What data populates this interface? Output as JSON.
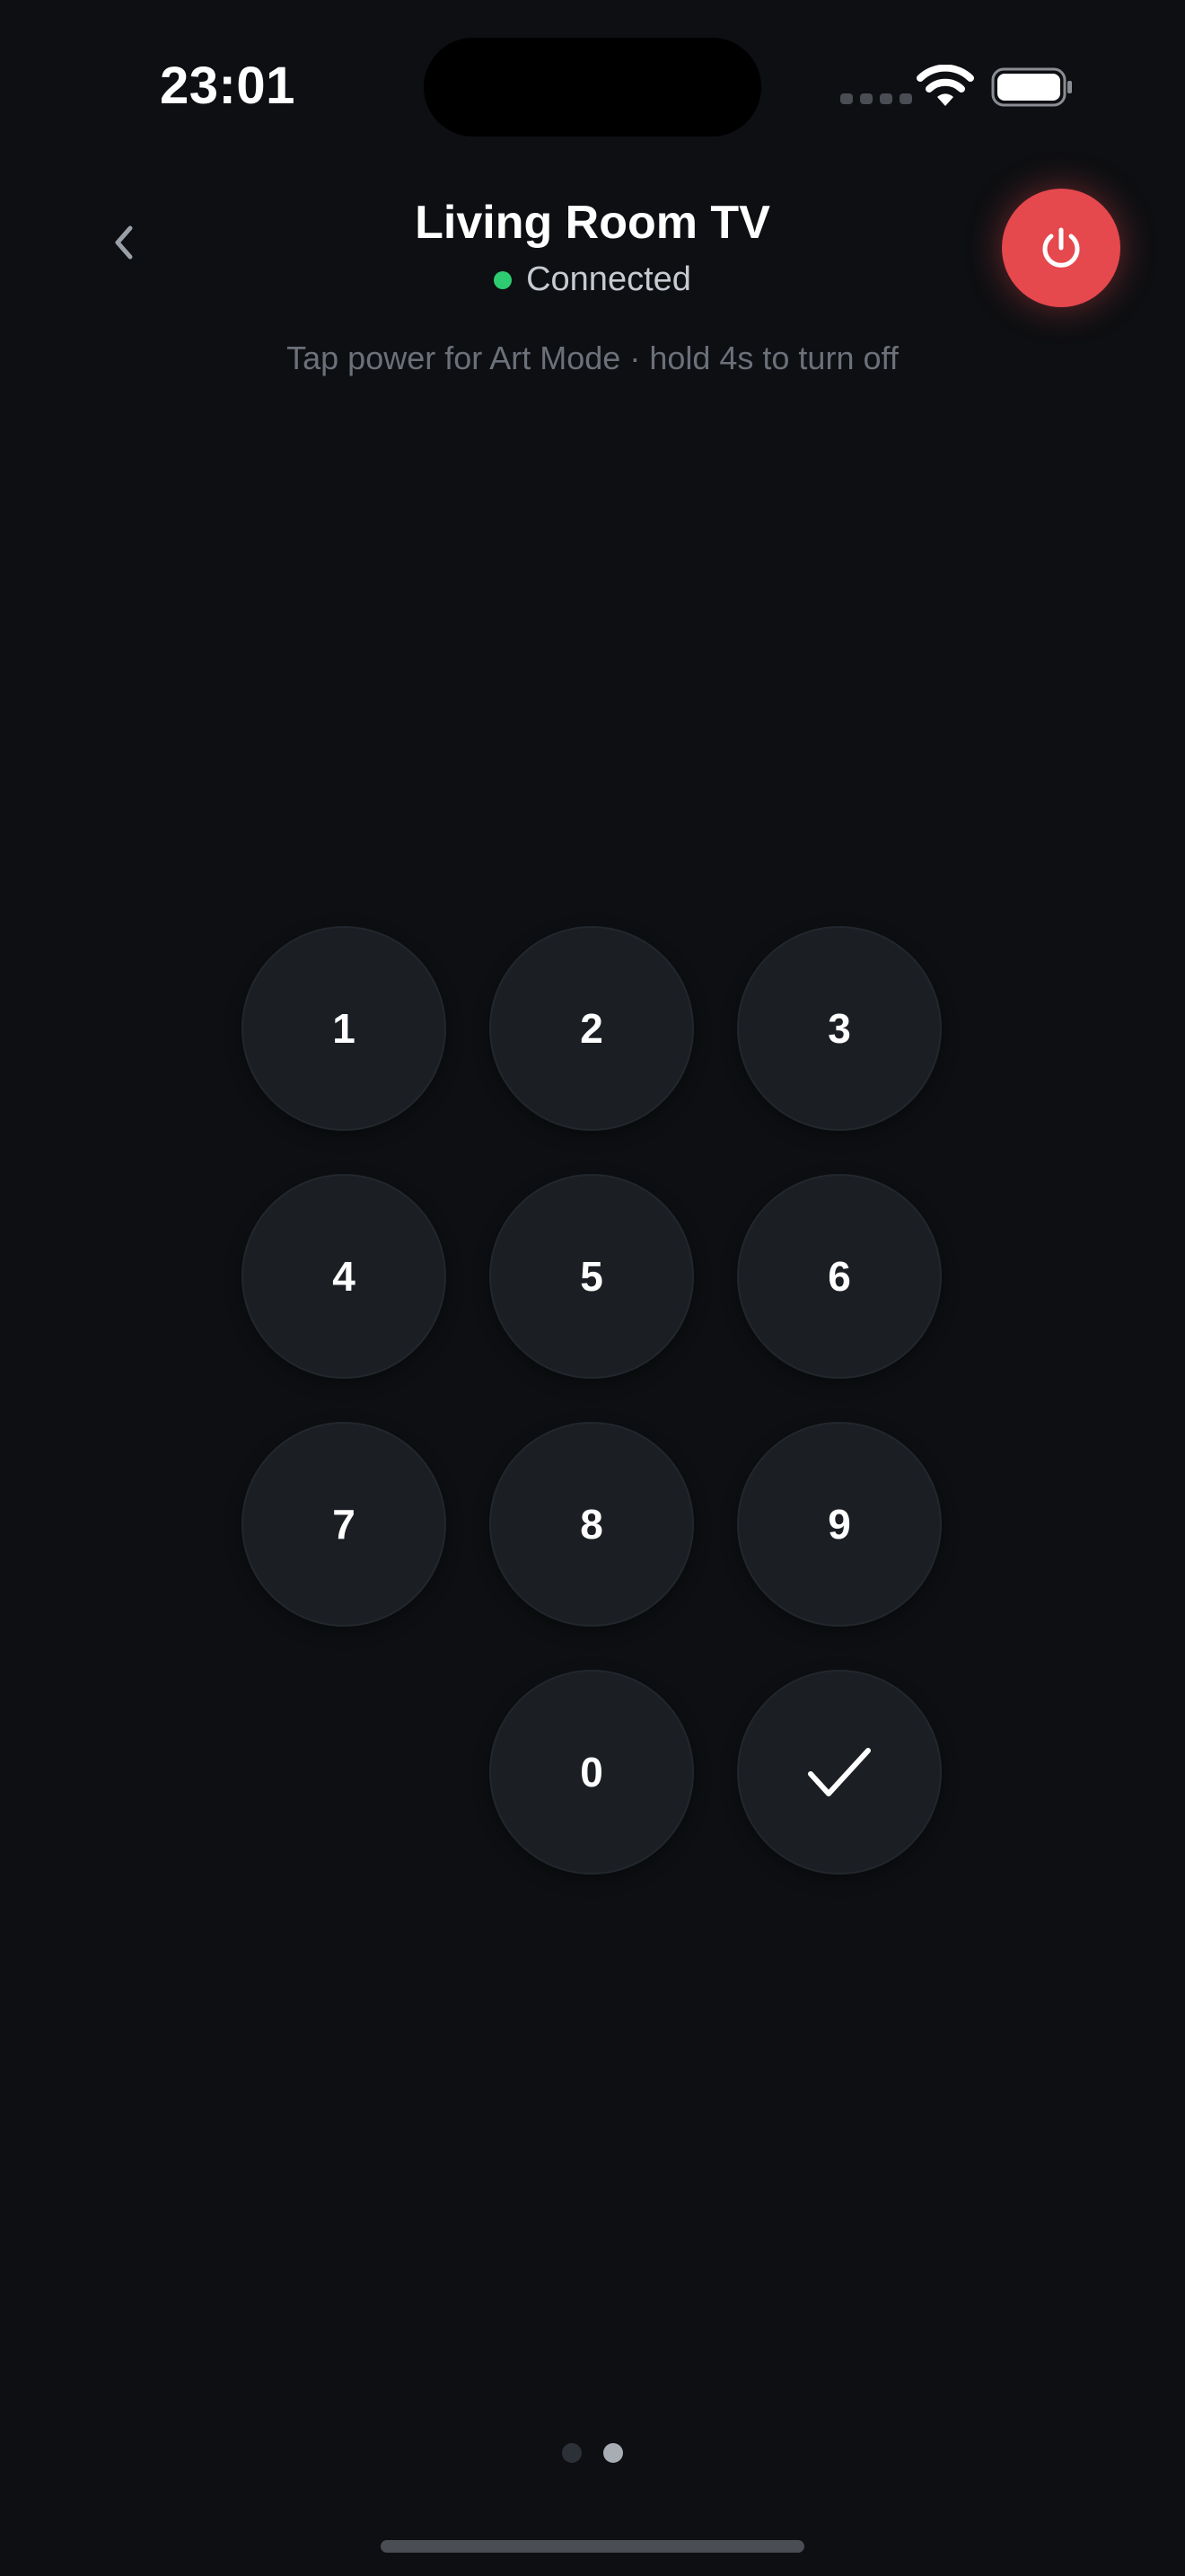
{
  "status_bar": {
    "time": "23:01"
  },
  "header": {
    "title": "Living Room TV",
    "connection_status": "Connected",
    "connection_color": "#2ecc71",
    "hint": "Tap power for Art Mode · hold 4s to turn off",
    "back_icon": "chevron-left-icon",
    "power_icon": "power-icon",
    "power_color": "#e5484d"
  },
  "keypad": {
    "keys": [
      "1",
      "2",
      "3",
      "4",
      "5",
      "6",
      "7",
      "8",
      "9",
      "0"
    ],
    "confirm_icon": "checkmark-icon"
  },
  "pager": {
    "page_count": 2,
    "active_page": 2
  }
}
